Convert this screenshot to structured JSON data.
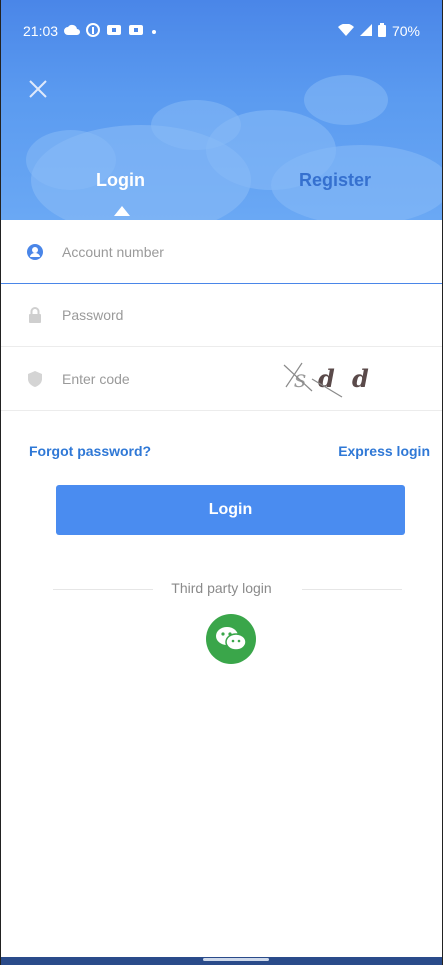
{
  "status_bar": {
    "time": "21:03",
    "battery_percent": "70%",
    "left_icons": [
      "cloud-icon",
      "facebook-icon",
      "app-icon",
      "app-icon",
      "dot-icon"
    ],
    "right_icons": [
      "wifi-icon",
      "signal-icon",
      "battery-icon"
    ]
  },
  "header": {
    "close_icon": "close-icon",
    "tabs": [
      {
        "label": "Login",
        "active": true
      },
      {
        "label": "Register",
        "active": false
      }
    ]
  },
  "form": {
    "account_placeholder": "Account number",
    "password_placeholder": "Password",
    "code_placeholder": "Enter code",
    "captcha_text": "sdd"
  },
  "links": {
    "forgot": "Forgot password?",
    "express": "Express login"
  },
  "buttons": {
    "login": "Login"
  },
  "third_party": {
    "label": "Third party login",
    "wechat_icon": "wechat-icon"
  },
  "colors": {
    "accent": "#4a8cf0",
    "header_blue": "#4a86e8",
    "wechat_green": "#3aa64a",
    "link_blue": "#2f78d6"
  }
}
